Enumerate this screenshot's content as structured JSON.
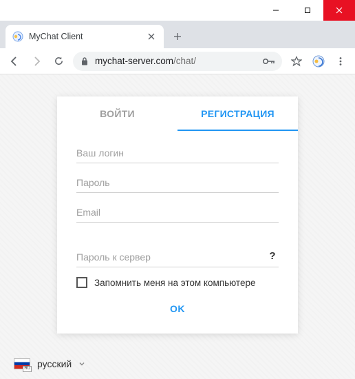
{
  "window": {
    "tab_title": "MyChat Client"
  },
  "address": {
    "host": "mychat-server.com",
    "path": "/chat/"
  },
  "auth": {
    "tabs": {
      "login": "ВОЙТИ",
      "register": "РЕГИСТРАЦИЯ"
    },
    "fields": {
      "login_ph": "Ваш логин",
      "password_ph": "Пароль",
      "email_ph": "Email",
      "server_password_ph": "Пароль к сервер",
      "help": "?"
    },
    "remember_label": "Запомнить меня на этом компьютере",
    "ok_label": "OK"
  },
  "language": {
    "label": "русский",
    "code": "RU"
  }
}
